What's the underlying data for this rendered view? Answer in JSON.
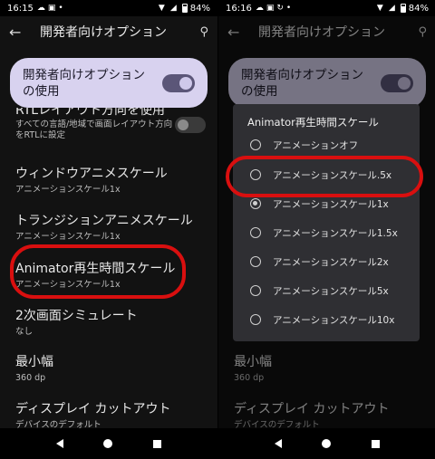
{
  "left": {
    "status": {
      "time": "16:15",
      "battery": "84%"
    },
    "appbar": {
      "title": "開発者向けオプション"
    },
    "master": {
      "label": "開発者向けオプションの使用"
    },
    "rtl_sub": "すべての言語/地域で画面レイアウト方向をRTLに設定",
    "rtl_title_cut": "RTLレイアウト方向を使用",
    "items": [
      {
        "title": "ウィンドウアニメスケール",
        "sub": "アニメーションスケール1x"
      },
      {
        "title": "トランジションアニメスケール",
        "sub": "アニメーションスケール1x"
      },
      {
        "title": "Animator再生時間スケール",
        "sub": "アニメーションスケール1x"
      },
      {
        "title": "2次画面シミュレート",
        "sub": "なし"
      },
      {
        "title": "最小幅",
        "sub": "360 dp"
      },
      {
        "title": "ディスプレイ カットアウト",
        "sub": "デバイスのデフォルト"
      }
    ]
  },
  "right": {
    "status": {
      "time": "16:16",
      "battery": "84%"
    },
    "appbar": {
      "title": "開発者向けオプション"
    },
    "master": {
      "label": "開発者向けオプションの使用"
    },
    "items": [
      {
        "title": "最小幅",
        "sub": "360 dp"
      },
      {
        "title": "ディスプレイ カットアウト",
        "sub": "デバイスのデフォルト"
      }
    ],
    "dialog": {
      "title": "Animator再生時間スケール",
      "options": [
        {
          "label": "アニメーションオフ",
          "selected": false
        },
        {
          "label": "アニメーションスケール.5x",
          "selected": false
        },
        {
          "label": "アニメーションスケール1x",
          "selected": true
        },
        {
          "label": "アニメーションスケール1.5x",
          "selected": false
        },
        {
          "label": "アニメーションスケール2x",
          "selected": false
        },
        {
          "label": "アニメーションスケール5x",
          "selected": false
        },
        {
          "label": "アニメーションスケール10x",
          "selected": false
        }
      ]
    }
  }
}
